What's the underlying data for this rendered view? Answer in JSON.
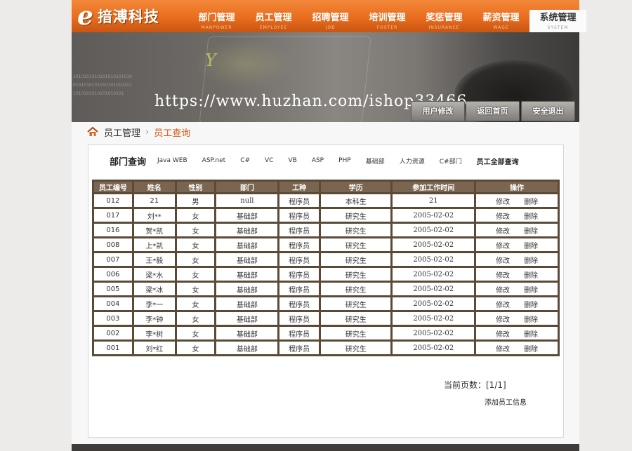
{
  "brand": {
    "logo_letter": "e",
    "name": "揞溥科技"
  },
  "nav": [
    {
      "label": "部门管理",
      "sub": "MANPOWER"
    },
    {
      "label": "员工管理",
      "sub": "EMPLOYEE"
    },
    {
      "label": "招聘管理",
      "sub": "JOB"
    },
    {
      "label": "培训管理",
      "sub": "FOSTER"
    },
    {
      "label": "奖惩管理",
      "sub": "INSURANCE"
    },
    {
      "label": "薪资管理",
      "sub": "WAGE"
    },
    {
      "label": "系统管理",
      "sub": "SYSTEM"
    }
  ],
  "banner": {
    "watermark": "https://www.huzhan.com/ishop33466",
    "buttons": [
      "用户修改",
      "返回首页",
      "安全退出"
    ]
  },
  "breadcrumb": {
    "section": "员工管理",
    "page": "员工查询"
  },
  "filters": {
    "title": "部门查询",
    "items": [
      "Java WEB",
      "ASP.net",
      "C#",
      "VC",
      "VB",
      "ASP",
      "PHP",
      "基础部",
      "人力资源",
      "C#部门"
    ],
    "all": "员工全部查询"
  },
  "table": {
    "headers": [
      "员工编号",
      "姓名",
      "性别",
      "部门",
      "工种",
      "学历",
      "参加工作时间",
      "操作"
    ],
    "rows": [
      [
        "012",
        "21",
        "男",
        "null",
        "程序员",
        "本科生",
        "21"
      ],
      [
        "017",
        "刘**",
        "女",
        "基础部",
        "程序员",
        "研究生",
        "2005-02-02"
      ],
      [
        "016",
        "贺*凯",
        "女",
        "基础部",
        "程序员",
        "研究生",
        "2005-02-02"
      ],
      [
        "008",
        "上*凯",
        "女",
        "基础部",
        "程序员",
        "研究生",
        "2005-02-02"
      ],
      [
        "007",
        "王*毅",
        "女",
        "基础部",
        "程序员",
        "研究生",
        "2005-02-02"
      ],
      [
        "006",
        "梁*水",
        "女",
        "基础部",
        "程序员",
        "研究生",
        "2005-02-02"
      ],
      [
        "005",
        "梁*冰",
        "女",
        "基础部",
        "程序员",
        "研究生",
        "2005-02-02"
      ],
      [
        "004",
        "李*一",
        "女",
        "基础部",
        "程序员",
        "研究生",
        "2005-02-02"
      ],
      [
        "003",
        "李*钟",
        "女",
        "基础部",
        "程序员",
        "研究生",
        "2005-02-02"
      ],
      [
        "002",
        "李*树",
        "女",
        "基础部",
        "程序员",
        "研究生",
        "2005-02-02"
      ],
      [
        "001",
        "刘*红",
        "女",
        "基础部",
        "程序员",
        "研究生",
        "2005-02-02"
      ]
    ],
    "op_edit": "修改",
    "op_delete": "删除"
  },
  "pager": {
    "text": "当前页数：[1/1]"
  },
  "add_link": "添加员工信息",
  "colors": {
    "nav_orange": "#e96d1e",
    "table_frame": "#5c4a38",
    "table_header": "#7a6650",
    "breadcrumb_accent": "#cf5a17"
  },
  "icons": {
    "home": "home-icon"
  }
}
